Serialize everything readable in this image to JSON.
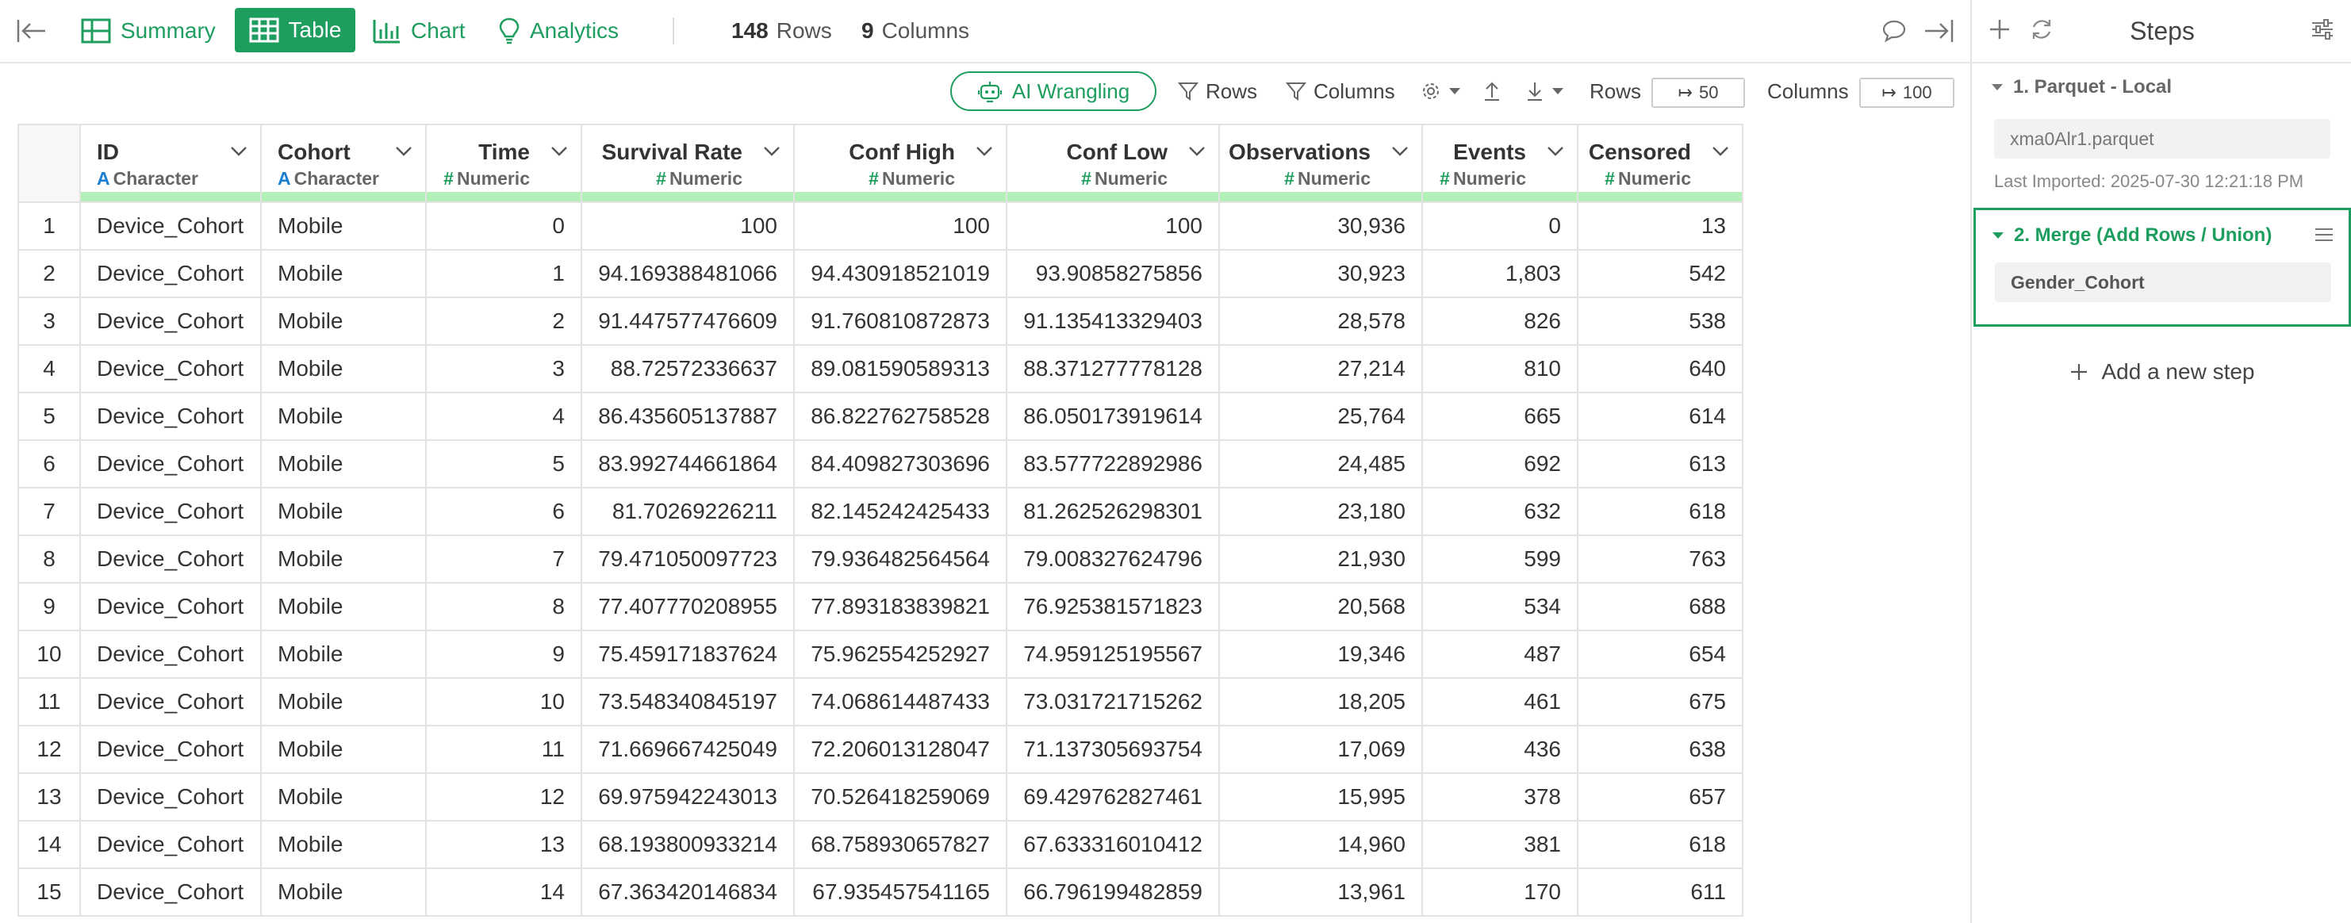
{
  "toolbar": {
    "tabs": {
      "summary": "Summary",
      "table": "Table",
      "chart": "Chart",
      "analytics": "Analytics"
    },
    "rows_count": "148",
    "rows_label": "Rows",
    "cols_count": "9",
    "cols_label": "Columns"
  },
  "actions": {
    "ai_wrangling": "AI Wrangling",
    "rows": "Rows",
    "columns": "Columns",
    "rows_limit_label": "Rows",
    "rows_limit_value": "50",
    "cols_limit_label": "Columns",
    "cols_limit_value": "100"
  },
  "table": {
    "columns": [
      {
        "name": "ID",
        "type": "Character",
        "type_symbol": "A"
      },
      {
        "name": "Cohort",
        "type": "Character",
        "type_symbol": "A"
      },
      {
        "name": "Time",
        "type": "Numeric",
        "type_symbol": "#"
      },
      {
        "name": "Survival Rate",
        "type": "Numeric",
        "type_symbol": "#"
      },
      {
        "name": "Conf High",
        "type": "Numeric",
        "type_symbol": "#"
      },
      {
        "name": "Conf Low",
        "type": "Numeric",
        "type_symbol": "#"
      },
      {
        "name": "Observations",
        "type": "Numeric",
        "type_symbol": "#"
      },
      {
        "name": "Events",
        "type": "Numeric",
        "type_symbol": "#"
      },
      {
        "name": "Censored",
        "type": "Numeric",
        "type_symbol": "#"
      }
    ],
    "rows": [
      [
        "1",
        "Device_Cohort",
        "Mobile",
        "0",
        "100",
        "100",
        "100",
        "30,936",
        "0",
        "13"
      ],
      [
        "2",
        "Device_Cohort",
        "Mobile",
        "1",
        "94.169388481066",
        "94.430918521019",
        "93.90858275856",
        "30,923",
        "1,803",
        "542"
      ],
      [
        "3",
        "Device_Cohort",
        "Mobile",
        "2",
        "91.447577476609",
        "91.760810872873",
        "91.135413329403",
        "28,578",
        "826",
        "538"
      ],
      [
        "4",
        "Device_Cohort",
        "Mobile",
        "3",
        "88.72572336637",
        "89.081590589313",
        "88.371277778128",
        "27,214",
        "810",
        "640"
      ],
      [
        "5",
        "Device_Cohort",
        "Mobile",
        "4",
        "86.435605137887",
        "86.822762758528",
        "86.050173919614",
        "25,764",
        "665",
        "614"
      ],
      [
        "6",
        "Device_Cohort",
        "Mobile",
        "5",
        "83.992744661864",
        "84.409827303696",
        "83.577722892986",
        "24,485",
        "692",
        "613"
      ],
      [
        "7",
        "Device_Cohort",
        "Mobile",
        "6",
        "81.70269226211",
        "82.145242425433",
        "81.262526298301",
        "23,180",
        "632",
        "618"
      ],
      [
        "8",
        "Device_Cohort",
        "Mobile",
        "7",
        "79.471050097723",
        "79.936482564564",
        "79.008327624796",
        "21,930",
        "599",
        "763"
      ],
      [
        "9",
        "Device_Cohort",
        "Mobile",
        "8",
        "77.407770208955",
        "77.893183839821",
        "76.925381571823",
        "20,568",
        "534",
        "688"
      ],
      [
        "10",
        "Device_Cohort",
        "Mobile",
        "9",
        "75.459171837624",
        "75.962554252927",
        "74.959125195567",
        "19,346",
        "487",
        "654"
      ],
      [
        "11",
        "Device_Cohort",
        "Mobile",
        "10",
        "73.548340845197",
        "74.068614487433",
        "73.031721715262",
        "18,205",
        "461",
        "675"
      ],
      [
        "12",
        "Device_Cohort",
        "Mobile",
        "11",
        "71.669667425049",
        "72.206013128047",
        "71.137305693754",
        "17,069",
        "436",
        "638"
      ],
      [
        "13",
        "Device_Cohort",
        "Mobile",
        "12",
        "69.975942243013",
        "70.526418259069",
        "69.429762827461",
        "15,995",
        "378",
        "657"
      ],
      [
        "14",
        "Device_Cohort",
        "Mobile",
        "13",
        "68.193800933214",
        "68.758930657827",
        "67.633316010412",
        "14,960",
        "381",
        "618"
      ],
      [
        "15",
        "Device_Cohort",
        "Mobile",
        "14",
        "67.363420146834",
        "67.935457541165",
        "66.796199482859",
        "13,961",
        "170",
        "611"
      ]
    ]
  },
  "steps": {
    "title": "Steps",
    "step1_title": "1. Parquet - Local",
    "step1_file": "xma0Alr1.parquet",
    "step1_imported": "Last Imported: 2025-07-30 12:21:18 PM",
    "step2_title": "2. Merge (Add Rows / Union)",
    "step2_target": "Gender_Cohort",
    "add_step": "Add a new step"
  },
  "colors": {
    "accent": "#1e9e5e",
    "char_type": "#1a7fd1",
    "column_bar": "#b4efba"
  }
}
